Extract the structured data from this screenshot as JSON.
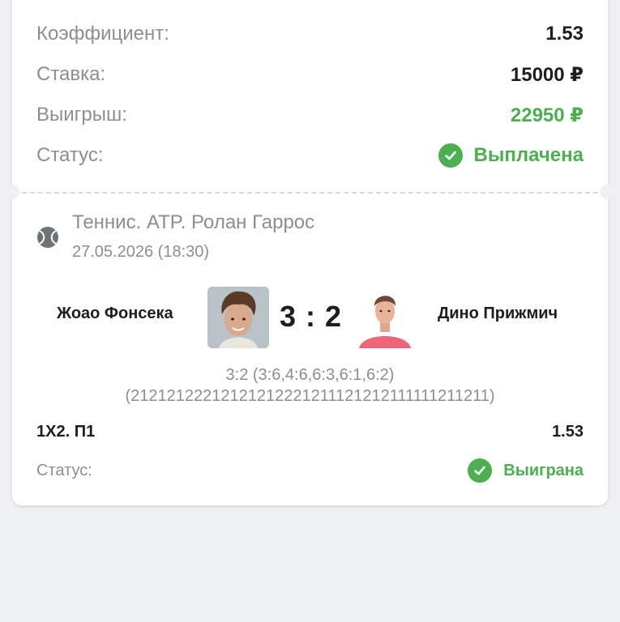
{
  "summary": {
    "coef_label": "Коэффициент:",
    "coef_value": "1.53",
    "stake_label": "Ставка:",
    "stake_value": "15000 ₽",
    "win_label": "Выигрыш:",
    "win_value": "22950 ₽",
    "status_label": "Статус:",
    "status_value": "Выплачена"
  },
  "event": {
    "icon": "tennis-ball-icon",
    "title": "Теннис. ATP. Ролан Гаррос",
    "date": "27.05.2026 (18:30)",
    "team1": "Жоао Фонсека",
    "team2": "Дино Прижмич",
    "score": "3 : 2",
    "sets_detail": "3:2 (3:6,4:6,6:3,6:1,6:2)",
    "points_detail": "(21212122212121212221211121212111111211211)"
  },
  "bet": {
    "name": "1X2. П1",
    "odds": "1.53",
    "status_label": "Статус:",
    "status_value": "Выиграна"
  },
  "colors": {
    "green": "#4caf50",
    "muted": "#8a8f94",
    "text": "#1e1e1e",
    "background": "#eef0f2"
  }
}
